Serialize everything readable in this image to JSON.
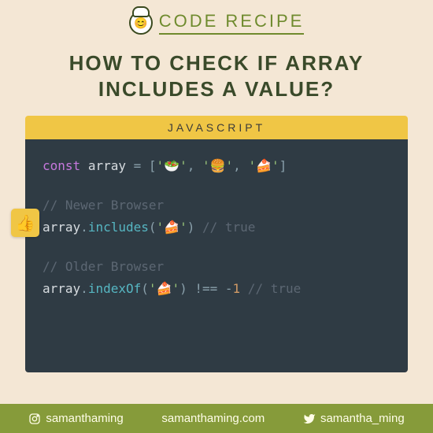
{
  "header": {
    "brand": "CODE RECIPE"
  },
  "title": "HOW TO CHECK IF ARRAY INCLUDES A VALUE?",
  "code": {
    "lang_label": "JAVASCRIPT",
    "decl_keyword": "const",
    "decl_var": "array",
    "decl_eq": " = ",
    "decl_open": "[",
    "decl_item1": "'🥗'",
    "decl_sep": ", ",
    "decl_item2": "'🍔'",
    "decl_item3": "'🍰'",
    "decl_close": "]",
    "newer_comment": "// Newer Browser",
    "newer_var": "array",
    "newer_dot": ".",
    "newer_fn": "includes",
    "newer_open": "(",
    "newer_arg": "'🍰'",
    "newer_close": ")",
    "newer_result": " // true",
    "older_comment": "// Older Browser",
    "older_var": "array",
    "older_dot": ".",
    "older_fn": "indexOf",
    "older_open": "(",
    "older_arg": "'🍰'",
    "older_close": ")",
    "older_op": " !== ",
    "older_neg": "-",
    "older_num": "1",
    "older_result": " // true"
  },
  "thumb_emoji": "👍",
  "footer": {
    "instagram": "samanthaming",
    "website": "samanthaming.com",
    "twitter": "samantha_ming"
  }
}
